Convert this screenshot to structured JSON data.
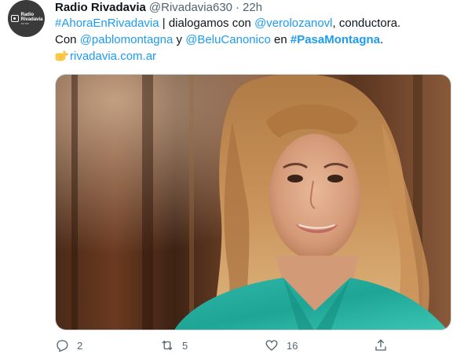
{
  "tweet": {
    "display_name": "Radio Rivadavia",
    "handle": "@Rivadavia630",
    "separator": "·",
    "time": "22h",
    "avatar": {
      "brand": "Radio",
      "brand2": "Rivadavia",
      "sub": "AM 630",
      "bg_color": "#3a3a3a"
    },
    "text": {
      "hashtag1": "#AhoraEnRivadavia",
      "part1": " | dialogamos con ",
      "mention1": "@verolozanovl",
      "part2": ", conductora.",
      "part3": "Con ",
      "mention2": "@pablomontagna",
      "part4": " y ",
      "mention3": "@BeluCanonico",
      "part5": " en ",
      "hashtag2": "#PasaMontagna",
      "part6": ".",
      "emoji": "pointing-right-emoji",
      "link": "rivadavia.com.ar"
    },
    "actions": {
      "reply_count": "2",
      "retweet_count": "5",
      "like_count": "16",
      "reply_icon": "reply-icon",
      "retweet_icon": "retweet-icon",
      "like_icon": "heart-icon",
      "share_icon": "share-icon"
    },
    "colors": {
      "link": "#1d9bf0",
      "secondary": "#536471",
      "text": "#0f1419"
    }
  }
}
